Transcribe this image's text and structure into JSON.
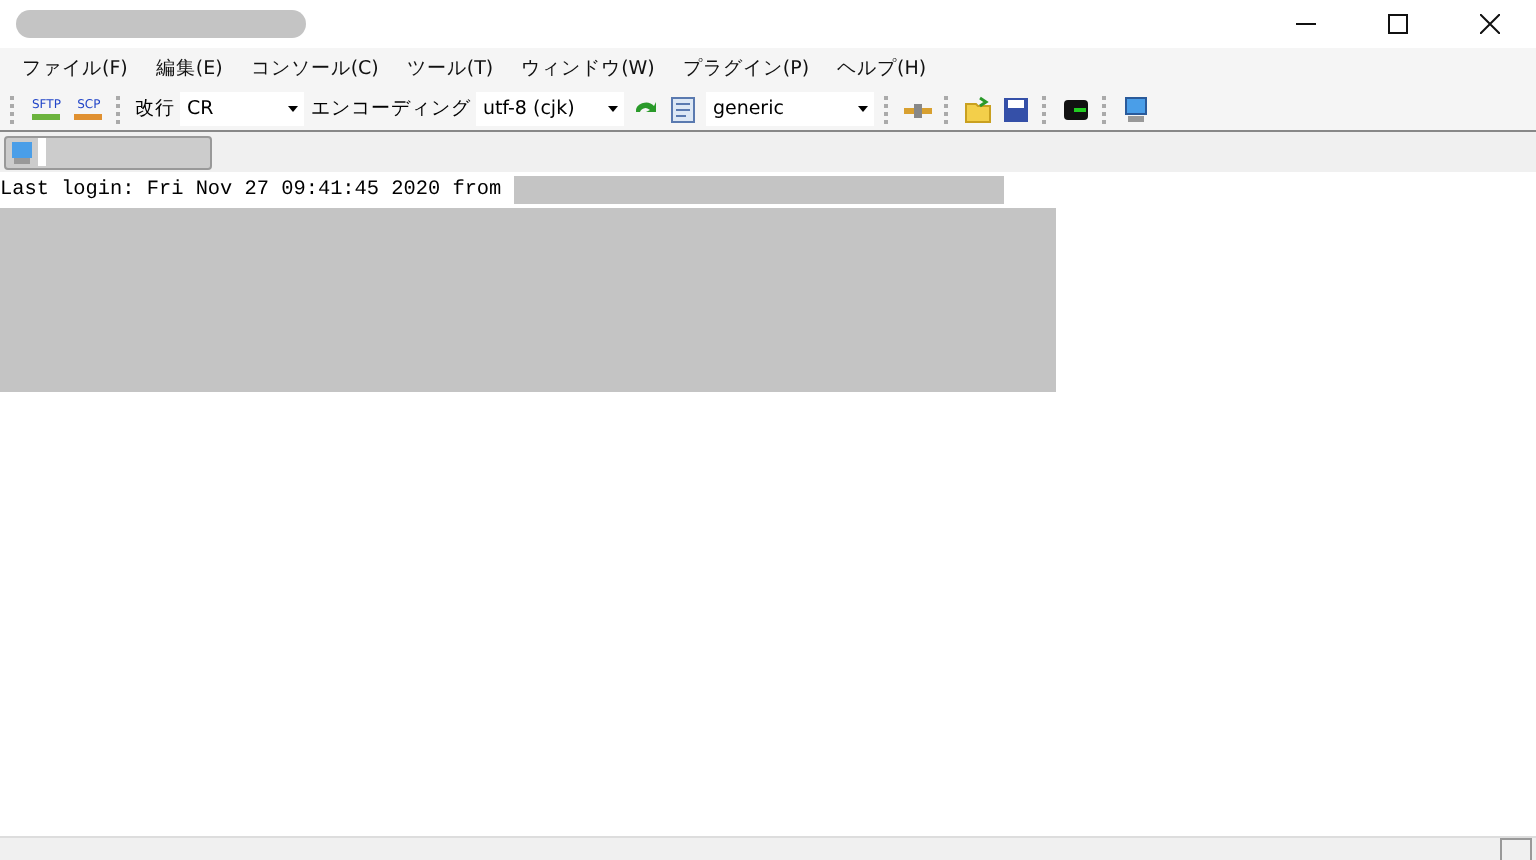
{
  "menu": [
    "ファイル(F)",
    "編集(E)",
    "コンソール(C)",
    "ツール(T)",
    "ウィンドウ(W)",
    "プラグイン(P)",
    "ヘルプ(H)"
  ],
  "toolbar": {
    "sftp": "SFTP",
    "scp": "SCP",
    "newline_label": "改行",
    "newline_value": "CR",
    "encoding_label": "エンコーディング",
    "encoding_value": "utf-8 (cjk)",
    "terminal_value": "generic"
  },
  "terminal": {
    "lines": [
      "Last login: Fri Nov 27 09:41:45 2020 from "
    ]
  }
}
